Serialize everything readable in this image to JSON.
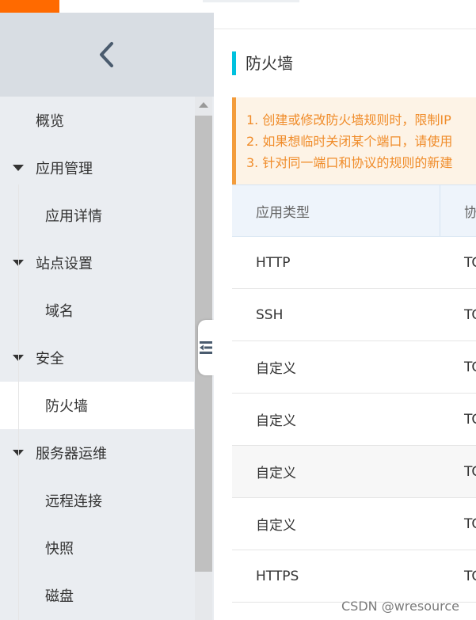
{
  "sidebar": {
    "collapse_icon": "chevron-left-icon",
    "items": [
      {
        "label": "概览"
      },
      {
        "label": "应用管理"
      },
      {
        "label": "应用详情"
      },
      {
        "label": "站点设置"
      },
      {
        "label": "域名"
      },
      {
        "label": "安全"
      },
      {
        "label": "防火墙"
      },
      {
        "label": "服务器运维"
      },
      {
        "label": "远程连接"
      },
      {
        "label": "快照"
      },
      {
        "label": "磁盘"
      }
    ],
    "toggle_icon": "collapse-menu-icon"
  },
  "page": {
    "title": "防火墙"
  },
  "notice": {
    "lines": [
      "1. 创建或修改防火墙规则时，限制IP",
      "2. 如果想临时关闭某个端口，请使用",
      "3. 针对同一端口和协议的规则的新建"
    ]
  },
  "table": {
    "headers": [
      "应用类型",
      "协"
    ],
    "rows": [
      {
        "type": "HTTP",
        "protocol": "TC"
      },
      {
        "type": "SSH",
        "protocol": "TC"
      },
      {
        "type": "自定义",
        "protocol": "TC"
      },
      {
        "type": "自定义",
        "protocol": "TC"
      },
      {
        "type": "自定义",
        "protocol": "TC"
      },
      {
        "type": "自定义",
        "protocol": "TC"
      },
      {
        "type": "HTTPS",
        "protocol": "TC"
      }
    ]
  },
  "watermark": "CSDN @wresource",
  "colors": {
    "brand": "#ff6a00",
    "title_accent": "#00c1de",
    "notice_text": "#f08c2a"
  }
}
